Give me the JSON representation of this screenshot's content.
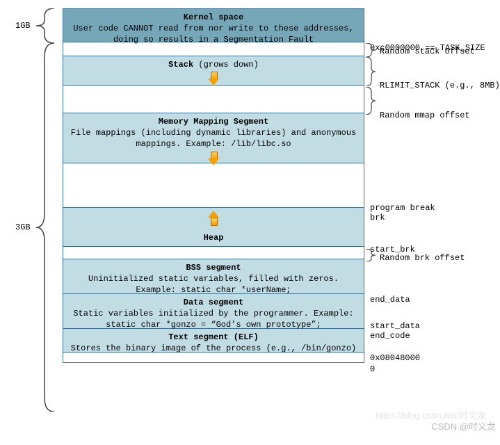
{
  "sizes": {
    "top": "1GB",
    "bottom": "3GB"
  },
  "segments": {
    "kernel": {
      "title": "Kernel space",
      "desc": "User code CANNOT read from nor write to these addresses, doing so results in a Segmentation Fault"
    },
    "stack": {
      "title": "Stack",
      "note": "(grows down)"
    },
    "mmap": {
      "title": "Memory Mapping Segment",
      "desc": "File mappings (including dynamic libraries) and anonymous mappings. Example: /lib/libc.so"
    },
    "heap": {
      "title": "Heap"
    },
    "bss": {
      "title": "BSS segment",
      "desc": "Uninitialized static variables, filled with zeros. Example: static char *userName;"
    },
    "data": {
      "title": "Data segment",
      "desc": "Static variables initialized by the programmer. Example: static char *gonzo = “God’s own prototype”;"
    },
    "text": {
      "title": "Text segment (ELF)",
      "desc": "Stores the binary image of the process (e.g., /bin/gonzo)"
    }
  },
  "right": {
    "task_size": "0xc0000000 == TASK_SIZE",
    "rand_stack": "Random stack offset",
    "rlimit": "RLIMIT_STACK (e.g., 8MB)",
    "rand_mmap": "Random mmap offset",
    "program_break": "program break",
    "brk": "brk",
    "start_brk": "start_brk",
    "rand_brk": "Random brk offset",
    "end_data": "end_data",
    "start_data": "start_data",
    "end_code": "end_code",
    "text_base": "0x08048000",
    "zero": "0"
  },
  "watermark": {
    "ghost": "https://blog.csdn.net/时义龙",
    "main": "CSDN @时义龙"
  }
}
